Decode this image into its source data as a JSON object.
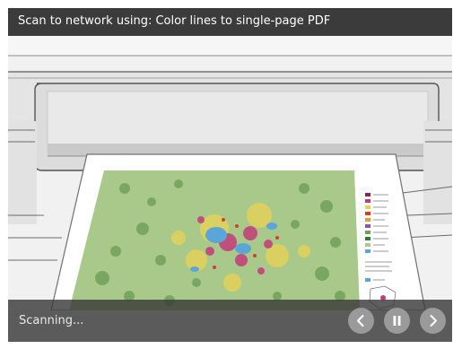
{
  "header": {
    "title": "Scan to network using: Color lines to single-page PDF"
  },
  "footer": {
    "status": "Scanning..."
  },
  "controls": {
    "previous": "chevron-left-icon",
    "pause": "pause-icon",
    "next": "chevron-right-icon"
  },
  "colors": {
    "titlebar": "#3b3b3b",
    "bottombar": "#3a3a3a",
    "button": "#9a9a9a",
    "map_land": "#a9c98a",
    "map_water": "#5aa6d8",
    "map_urban": "#c23b7a"
  }
}
